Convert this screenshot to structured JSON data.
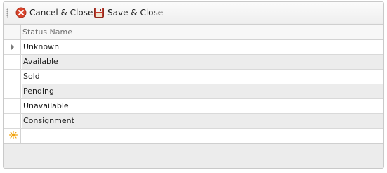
{
  "toolbar": {
    "cancel_label": "Cancel & Close",
    "save_label": "Save & Close"
  },
  "grid": {
    "column_header": "Status Name",
    "rows": [
      {
        "label": "Unknown"
      },
      {
        "label": "Available"
      },
      {
        "label": "Sold"
      },
      {
        "label": "Pending"
      },
      {
        "label": "Unavailable"
      },
      {
        "label": "Consignment"
      }
    ],
    "new_row_value": ""
  },
  "colors": {
    "cancel_icon": "#d9432b",
    "save_icon": "#c0392b",
    "new_row_star": "#f2a20c",
    "alt_row": "#ececec"
  },
  "icons": {
    "cancel": "cancel-icon",
    "save": "save-icon",
    "current_row": "current-row-caret-icon",
    "new_row": "new-row-star-icon"
  }
}
